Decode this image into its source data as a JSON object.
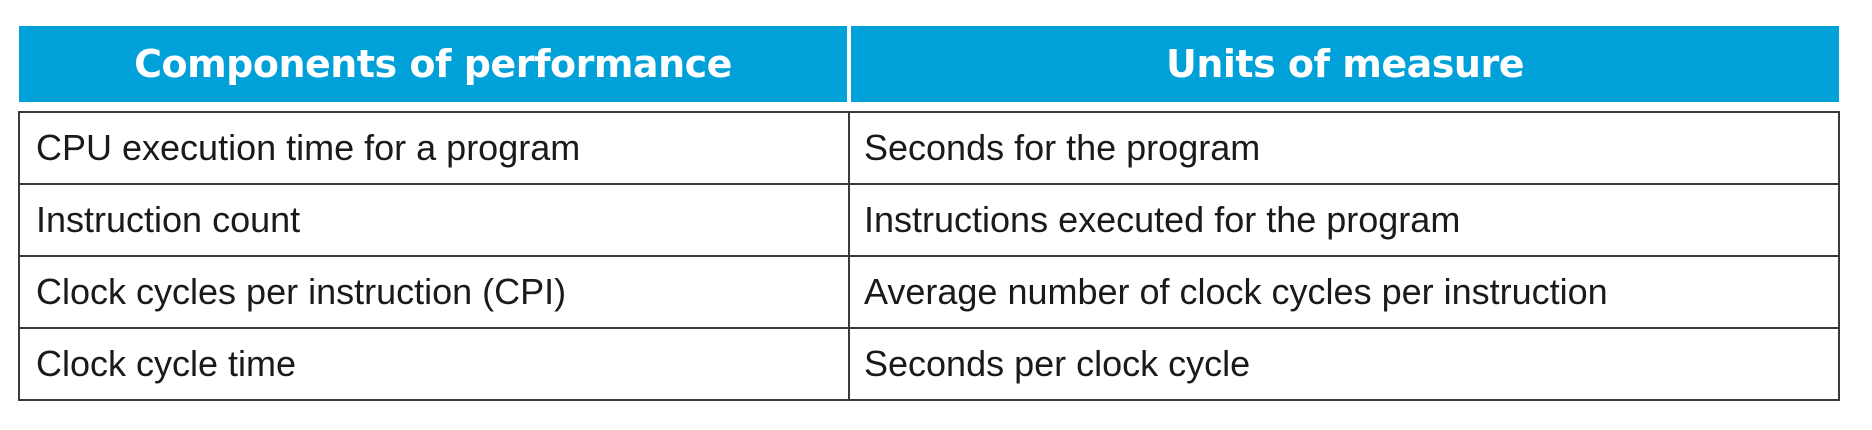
{
  "table": {
    "headers": [
      "Components of performance",
      "Units of measure"
    ],
    "rows": [
      [
        "CPU execution time for a program",
        "Seconds for the program"
      ],
      [
        "Instruction count",
        "Instructions executed for the program"
      ],
      [
        "Clock cycles per instruction (CPI)",
        "Average number of clock cycles per instruction"
      ],
      [
        "Clock cycle time",
        "Seconds per clock cycle"
      ]
    ]
  },
  "colors": {
    "header_bg": "#00a0d8",
    "header_text": "#ffffff",
    "border": "#3a3a3a",
    "body_text": "#1a1a1a"
  }
}
